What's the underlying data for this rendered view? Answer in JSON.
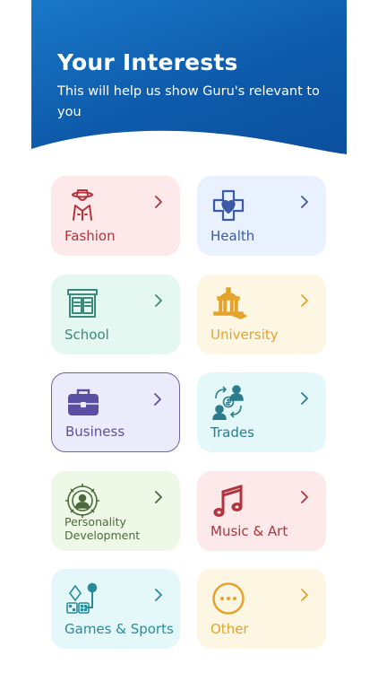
{
  "header": {
    "title": "Your Interests",
    "subtitle": "This will help us show Guru's relevant to you"
  },
  "colors": {
    "header_blue": "#0e5aaa",
    "fashion": "#b0343d",
    "health": "#3b5aa8",
    "school": "#3a8a7a",
    "university": "#e5a32d",
    "business": "#5a4fa2",
    "trades": "#2a7c8e",
    "personality": "#4b6a3a",
    "music": "#b0343d",
    "games": "#2a8a9a",
    "other": "#e5a32d"
  },
  "interests": [
    {
      "label": "Fashion",
      "icon": "fashion-icon",
      "selected": false
    },
    {
      "label": "Health",
      "icon": "health-icon",
      "selected": false
    },
    {
      "label": "School",
      "icon": "school-icon",
      "selected": false
    },
    {
      "label": "University",
      "icon": "university-icon",
      "selected": false
    },
    {
      "label": "Business",
      "icon": "briefcase-icon",
      "selected": true
    },
    {
      "label": "Trades",
      "icon": "trades-icon",
      "selected": false
    },
    {
      "label": "Personality Development",
      "icon": "personality-icon",
      "selected": false
    },
    {
      "label": "Music & Art",
      "icon": "music-notes-icon",
      "selected": false
    },
    {
      "label": "Games & Sports",
      "icon": "games-icon",
      "selected": false
    },
    {
      "label": "Other",
      "icon": "more-icon",
      "selected": false
    }
  ]
}
